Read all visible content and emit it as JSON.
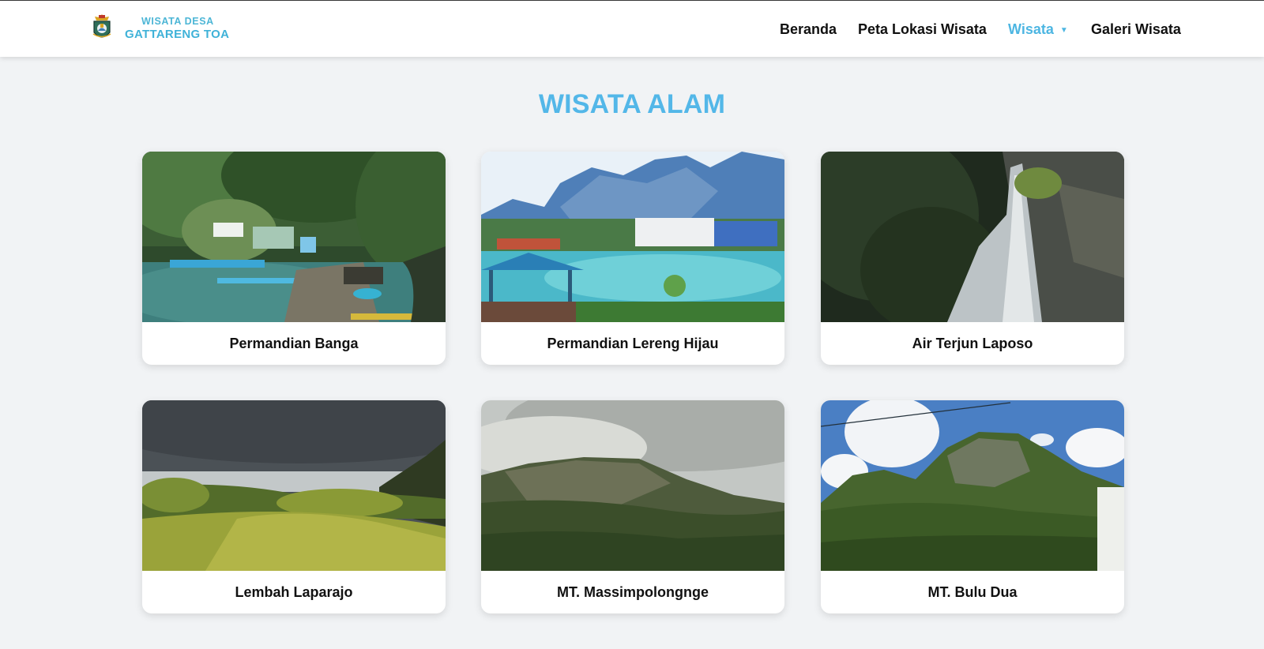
{
  "brand": {
    "line1": "WISATA DESA",
    "line2": "GATTARENG TOA",
    "logo_icon": "regency-emblem-icon"
  },
  "nav": {
    "items": [
      {
        "label": "Beranda"
      },
      {
        "label": "Peta Lokasi Wisata"
      },
      {
        "label": "Wisata",
        "active": true,
        "dropdown_icon": "caret-down-icon",
        "caret": "▼"
      },
      {
        "label": "Galeri Wisata"
      }
    ]
  },
  "main": {
    "title": "WISATA ALAM",
    "cards": [
      {
        "title": "Permandian Banga"
      },
      {
        "title": "Permandian Lereng Hijau"
      },
      {
        "title": "Air Terjun Laposo"
      },
      {
        "title": "Lembah Laparajo"
      },
      {
        "title": "MT. Massimpolongnge"
      },
      {
        "title": "MT. Bulu Dua"
      }
    ]
  },
  "colors": {
    "accent": "#53b7e8",
    "page_background": "#f1f3f5",
    "nav_text": "#111111"
  }
}
